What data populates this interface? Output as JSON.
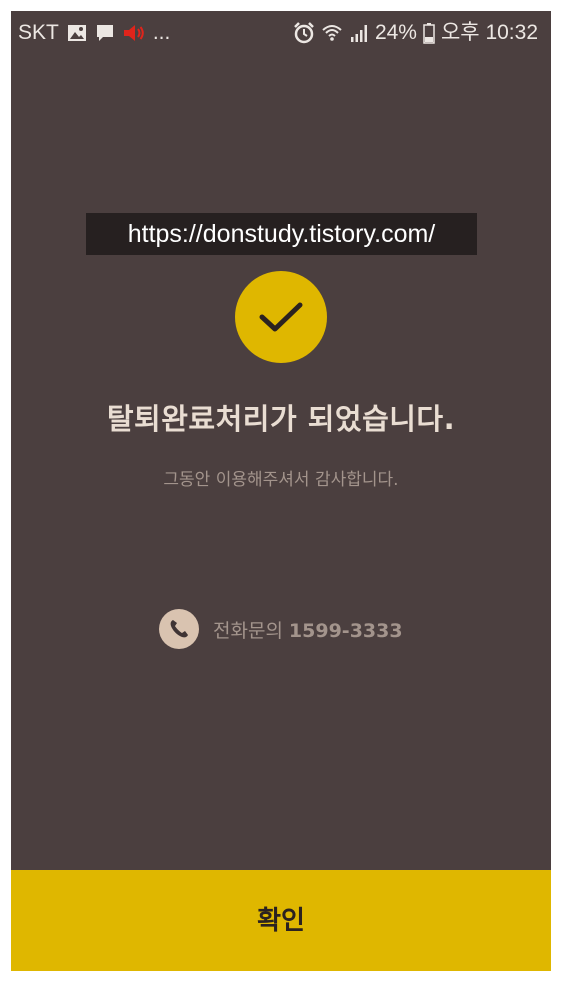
{
  "status_bar": {
    "carrier": "SKT",
    "more": "...",
    "battery_percent": "24%",
    "time": "오후 10:32",
    "left_icons": [
      "gallery-icon",
      "message-icon",
      "volume-icon"
    ],
    "right_icons": [
      "alarm-icon",
      "wifi-icon",
      "signal-icon",
      "battery-icon"
    ]
  },
  "watermark": "https://donstudy.tistory.com/",
  "main": {
    "check_icon": "check-icon",
    "title": "탈퇴완료처리가 되었습니다.",
    "subtitle": "그동안 이용해주셔서 감사합니다.",
    "phone_label": "전화문의",
    "phone_number": "1599-3333"
  },
  "footer": {
    "confirm_label": "확인"
  },
  "colors": {
    "background": "#4b3f3f",
    "accent": "#dfb700",
    "title_text": "#e9ddd2",
    "muted_text": "#a3948c",
    "phone_icon_bg": "#d9c3b0",
    "volume_icon": "#e0241b"
  }
}
